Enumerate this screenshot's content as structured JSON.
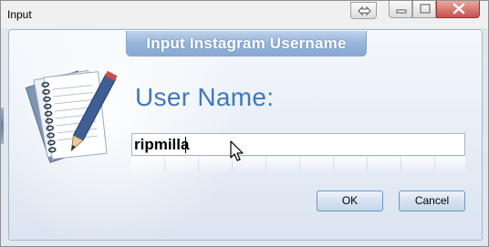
{
  "window": {
    "title": "Input"
  },
  "titlebar_buttons": {
    "resize_icon": "double-arrow-icon",
    "minimize_icon": "minimize-icon",
    "maximize_icon": "maximize-icon",
    "close_icon": "close-icon"
  },
  "dialog": {
    "header": "Input Instagram Username",
    "illustration_icon": "notepad-pencil-icon",
    "field_label": "User Name:",
    "username_value": "ripmilla",
    "ok_label": "OK",
    "cancel_label": "Cancel"
  },
  "colors": {
    "accent": "#3f78bd",
    "header_bg": "#98b5d9",
    "close_button": "#c75050"
  }
}
